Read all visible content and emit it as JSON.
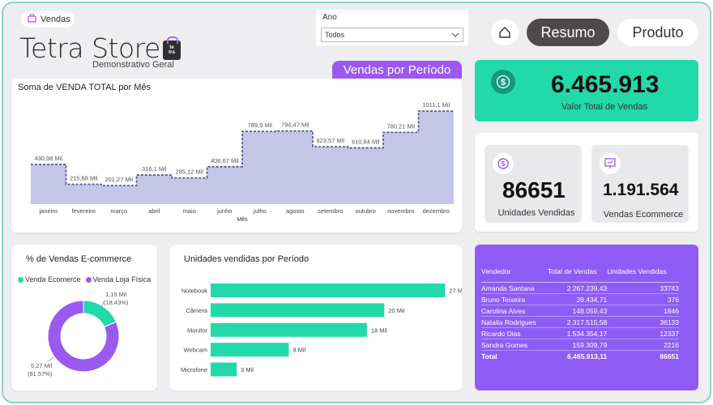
{
  "header": {
    "tab_label": "Vendas",
    "brand_title": "Tetra Store",
    "brand_subtitle": "Demonstrativo Geral",
    "logo_text": "te tra"
  },
  "filter": {
    "label": "Ano",
    "value": "Todos"
  },
  "nav": {
    "resumo": "Resumo",
    "produto": "Produto"
  },
  "period_banner": "Vendas por Período",
  "colors": {
    "green": "#22d9aa",
    "purple": "#9b59f0",
    "area": "#c5c5e8",
    "dark": "#4e4a4a"
  },
  "monthly_chart": {
    "title": "Soma de VENDA TOTAL por Mês",
    "x_axis_label": "Mês"
  },
  "kpis": {
    "total_value": "6.465.913",
    "total_label": "Valor Total de Vendas",
    "units_value": "86651",
    "units_label": "Unidades Vendidas",
    "ecom_value": "1.191.564",
    "ecom_label": "Vendas Ecommerce"
  },
  "donut": {
    "title": "% de Vendas E-commerce",
    "legend_ecom": "Venda Ecomerce",
    "legend_fisica": "Venda Loja Física",
    "label_ecom_value": "1,19 Mil",
    "label_ecom_pct": "(18,43%)",
    "label_fisica_value": "5,27 Mil",
    "label_fisica_pct": "(81,57%)"
  },
  "bars": {
    "title": "Unidades vendidas por Período"
  },
  "sellers_table": {
    "headers": [
      "Vendedor",
      "Total de Vendas",
      "Unidades Vendidas"
    ],
    "rows": [
      [
        "Amanda Santana",
        "2.267.239,43",
        "33743"
      ],
      [
        "Bruno Teixeira",
        "39.434,71",
        "376"
      ],
      [
        "Carolina Alves",
        "148.059,43",
        "1846"
      ],
      [
        "Natalia Rodrigues",
        "2.317.515,58",
        "36133"
      ],
      [
        "Ricardo Dias",
        "1.534.354,17",
        "12337"
      ],
      [
        "Sandra Gomes",
        "159.309,79",
        "2216"
      ]
    ],
    "total": [
      "Total",
      "6.465.913,11",
      "86651"
    ]
  },
  "chart_data": [
    {
      "type": "area",
      "title": "Soma de VENDA TOTAL por Mês",
      "xlabel": "Mês",
      "ylabel": "",
      "categories": [
        "janeiro",
        "fevereiro",
        "março",
        "abril",
        "maio",
        "junho",
        "julho",
        "agosto",
        "setembro",
        "outubro",
        "novembro",
        "dezembro"
      ],
      "values": [
        430980,
        215680,
        201270,
        316100,
        285120,
        406670,
        789900,
        794470,
        623570,
        610840,
        780210,
        1011100
      ],
      "data_labels": [
        "430,98 Mil",
        "215,68 Mil",
        "201,27 Mil",
        "316,1 Mil",
        "285,12 Mil",
        "406,67 Mil",
        "789,9 Mil",
        "794,47 Mil",
        "623,57 Mil",
        "610,84 Mil",
        "780,21 Mil",
        "1011,1 Mil"
      ],
      "ylim": [
        0,
        1100000
      ],
      "grid": false
    },
    {
      "type": "bar",
      "orientation": "horizontal",
      "title": "Unidades vendidas por Periodo",
      "categories": [
        "Notebook",
        "Câmera",
        "Monitor",
        "Webcam",
        "Microfone"
      ],
      "values": [
        27000,
        20000,
        18000,
        9000,
        3000
      ],
      "data_labels": [
        "27 Mil",
        "20 Mil",
        "18 Mil",
        "9 Mil",
        "3 Mil"
      ],
      "xlim": [
        0,
        28000
      ]
    },
    {
      "type": "pie",
      "donut": true,
      "title": "% de Vendas E-commerce",
      "categories": [
        "Venda Ecomerce",
        "Venda Loja Física"
      ],
      "values": [
        1190,
        5270
      ],
      "percent": [
        18.43,
        81.57
      ],
      "legend": "top-left"
    }
  ]
}
